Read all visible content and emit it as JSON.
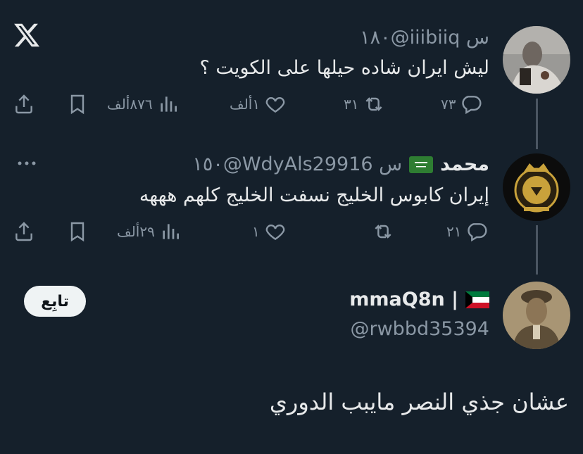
{
  "tweets": [
    {
      "handle_time": "١٨٠@iiibiiq س",
      "text": "ليش ايران شاده حيلها على الكويت ؟",
      "replies": "٧٣",
      "retweets": "٣١",
      "likes": "١ألف",
      "views": "٨٧٦ألف"
    },
    {
      "name": "محمد",
      "flag": "saudi-flag",
      "handle_time": "١٥٠@WdyAls29916 س",
      "text": "إيران كابوس الخليج نسفت الخليج كلهم هههه",
      "replies": "٢١",
      "retweets": "",
      "likes": "١",
      "views": "٢٩ألف"
    }
  ],
  "main_tweet": {
    "name": "mmaQ8n |",
    "flag": "kuwait-flag",
    "handle": "@rwbbd35394",
    "follow_label": "تابِع",
    "text": "عشان جذي النصر مايبب الدوري"
  },
  "colors": {
    "background": "#15202b",
    "text": "#e7e9ea",
    "muted": "#8b98a5",
    "thread_line": "#4a5561"
  }
}
